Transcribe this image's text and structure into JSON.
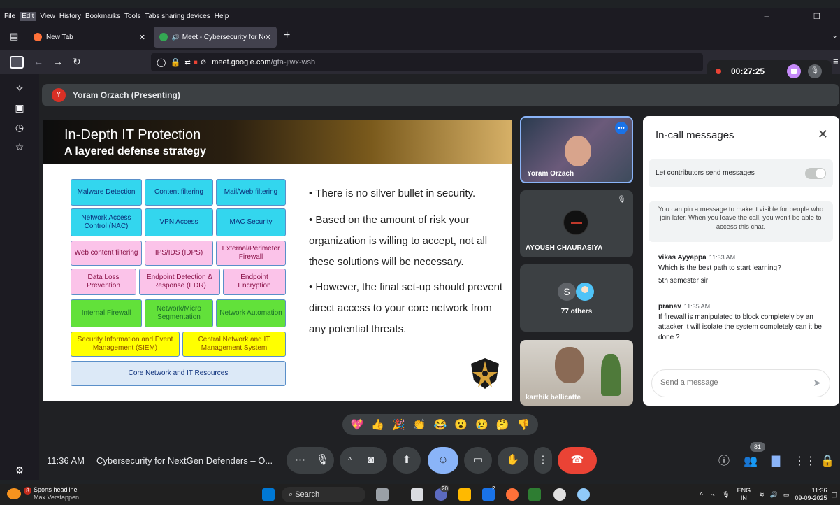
{
  "browser": {
    "menu": [
      "File",
      "Edit",
      "View",
      "History",
      "Bookmarks",
      "Tools",
      "Tabs sharing devices",
      "Help"
    ],
    "tabs": [
      {
        "title": "New Tab"
      },
      {
        "title": "Meet - Cybersecurity for Ne"
      }
    ],
    "url_domain": "meet.google.com",
    "url_path": "/gta-jiwx-wsh"
  },
  "meet": {
    "presenter_initial": "Y",
    "presenter_label": "Yoram Orzach (Presenting)",
    "recording_time": "00:27:25",
    "slide": {
      "title": "In-Depth IT Protection",
      "subtitle": "A layered defense strategy",
      "boxes": {
        "malware": "Malware Detection",
        "content": "Content filtering",
        "mailweb": "Mail/Web filtering",
        "nac": "Network Access Control (NAC)",
        "vpn": "VPN Access",
        "mac": "MAC Security",
        "webcontent": "Web content filtering",
        "ips": "IPS/IDS (IDPS)",
        "perimeter": "External/Perimeter Firewall",
        "dlp": "Data Loss Prevention",
        "edr": "Endpoint Detection & Response (EDR)",
        "encryption": "Endpoint Encryption",
        "internal_fw": "Internal Firewall",
        "microseg": "Network/Micro Segmentation",
        "automation": "Network Automation",
        "siem": "Security Information and Event Management (SIEM)",
        "central": "Central Network and IT Management System",
        "core": "Core Network and IT Resources"
      },
      "bullets": [
        "There is no silver bullet in security.",
        "Based on the amount of risk your organization is willing to accept, not all these solutions will be necessary.",
        "However, the final set-up should prevent direct access to your core network from any potential threats."
      ]
    },
    "tiles": {
      "yoram": "Yoram Orzach",
      "ayoush": "AYOUSH CHAURASIYA",
      "others_initial": "S",
      "others": "77 others",
      "karthik": "karthik bellicatte"
    },
    "chat": {
      "title": "In-call messages",
      "toggle_label": "Let contributors send messages",
      "info": "You can pin a message to make it visible for people who join later. When you leave the call, you won't be able to access this chat.",
      "messages": [
        {
          "sender": "vikas Ayyappa",
          "time": "11:33 AM",
          "lines": [
            "Which is the best path to start learning?",
            "5th semester sir"
          ]
        },
        {
          "sender": "pranav",
          "time": "11:35 AM",
          "lines": [
            "If firewall is manipulated to block completely by an attacker it will isolate the system completely can it be done ?"
          ]
        }
      ],
      "input_placeholder": "Send a message"
    },
    "reactions": [
      "💖",
      "👍",
      "🎉",
      "👏",
      "😂",
      "😮",
      "😢",
      "🤔",
      "👎"
    ],
    "clock": "11:36 AM",
    "meeting_name": "Cybersecurity for NextGen Defenders – O...",
    "people_count": "81"
  },
  "taskbar": {
    "news_badge": "8",
    "news_title": "Sports headline",
    "news_sub": "Max Verstappen...",
    "search_label": "Search",
    "teams_badge": "20",
    "app_badge": "2",
    "lang": "ENG",
    "region": "IN",
    "time": "11:36",
    "date": "09-09-2025"
  },
  "colors": {
    "accent": "#8ab4f8",
    "hangup": "#ea4335",
    "recording": "#ea4335"
  }
}
